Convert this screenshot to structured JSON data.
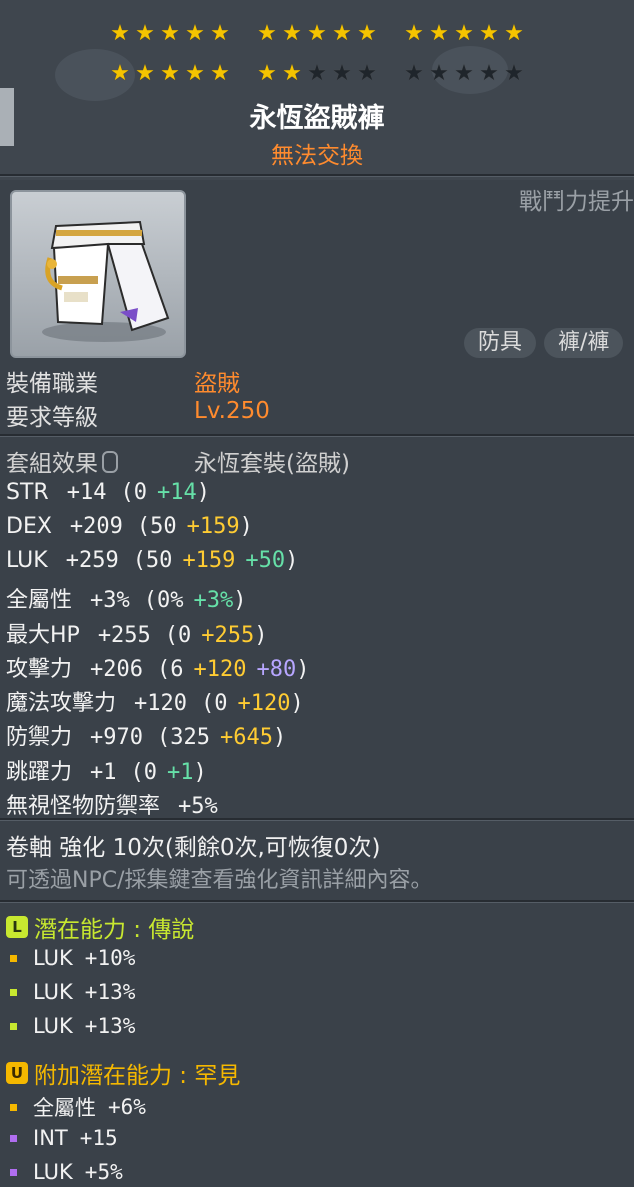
{
  "stars": {
    "rows": [
      [
        [
          1,
          1,
          1,
          1,
          1
        ],
        [
          1,
          1,
          1,
          1,
          1
        ],
        [
          1,
          1,
          1,
          1,
          1
        ]
      ],
      [
        [
          1,
          1,
          1,
          1,
          1
        ],
        [
          1,
          1,
          0,
          0,
          0
        ],
        [
          0,
          0,
          0,
          0,
          0
        ]
      ]
    ],
    "on_color": "#f5c400",
    "off_color": "#1f252b"
  },
  "item": {
    "name": "永恆盜賊褲",
    "tradeable": "無法交換",
    "icon": "white-gold-pants-icon"
  },
  "combat_power_label": "戰鬥力提升",
  "categories": [
    "防具",
    "褲/褲"
  ],
  "requirements": [
    {
      "label": "裝備職業",
      "value": "盜賊"
    },
    {
      "label": "要求等級",
      "value": "Lv.250"
    }
  ],
  "set_effect": {
    "label": "套組效果",
    "name": "永恆套裝(盜賊)"
  },
  "stats": [
    {
      "name": "STR",
      "total": "+14",
      "base": "(0",
      "adds": [
        {
          "v": "+14",
          "c": "g"
        }
      ],
      "close": ")"
    },
    {
      "name": "DEX",
      "total": "+209",
      "base": "(50",
      "adds": [
        {
          "v": "+159",
          "c": "y"
        }
      ],
      "close": ")"
    },
    {
      "name": "LUK",
      "total": "+259",
      "base": "(50",
      "adds": [
        {
          "v": "+159",
          "c": "y"
        },
        {
          "v": "+50",
          "c": "g"
        }
      ],
      "close": ")"
    },
    {
      "name": "全屬性",
      "total": "+3%",
      "base": "(0%",
      "adds": [
        {
          "v": "+3%",
          "c": "g"
        }
      ],
      "close": ")"
    },
    {
      "name": "最大HP",
      "total": "+255",
      "base": "(0",
      "adds": [
        {
          "v": "+255",
          "c": "y"
        }
      ],
      "close": ")"
    },
    {
      "name": "攻擊力",
      "total": "+206",
      "base": "(6",
      "adds": [
        {
          "v": "+120",
          "c": "y"
        },
        {
          "v": "+80",
          "c": "p"
        }
      ],
      "close": ")"
    },
    {
      "name": "魔法攻擊力",
      "total": "+120",
      "base": "(0",
      "adds": [
        {
          "v": "+120",
          "c": "y"
        }
      ],
      "close": ")"
    },
    {
      "name": "防禦力",
      "total": "+970",
      "base": "(325",
      "adds": [
        {
          "v": "+645",
          "c": "y"
        }
      ],
      "close": ")"
    },
    {
      "name": "跳躍力",
      "total": "+1",
      "base": "(0",
      "adds": [
        {
          "v": "+1",
          "c": "g"
        }
      ],
      "close": ")"
    },
    {
      "name": "無視怪物防禦率",
      "total": "+5%",
      "base": "",
      "adds": [],
      "close": ""
    }
  ],
  "scroll": "卷軸 強化 10次(剩餘0次,可恢復0次)",
  "hint": "可透過NPC/採集鍵查看強化資訊詳細內容。",
  "potential": {
    "badge": "L",
    "title": "潛在能力 : 傳說",
    "color": "#c8e830",
    "lines": [
      {
        "stat": "LUK",
        "value": "+10%",
        "dot": "#f5b800"
      },
      {
        "stat": "LUK",
        "value": "+13%",
        "dot": "#c8e830"
      },
      {
        "stat": "LUK",
        "value": "+13%",
        "dot": "#c8e830"
      }
    ]
  },
  "bonus_potential": {
    "badge": "U",
    "title": "附加潛在能力 : 罕見",
    "color": "#f5b800",
    "lines": [
      {
        "stat": "全屬性",
        "value": "+6%",
        "dot": "#f5b800"
      },
      {
        "stat": "INT",
        "value": "+15",
        "dot": "#b06ef0"
      },
      {
        "stat": "LUK",
        "value": "+5%",
        "dot": "#b06ef0"
      }
    ]
  }
}
